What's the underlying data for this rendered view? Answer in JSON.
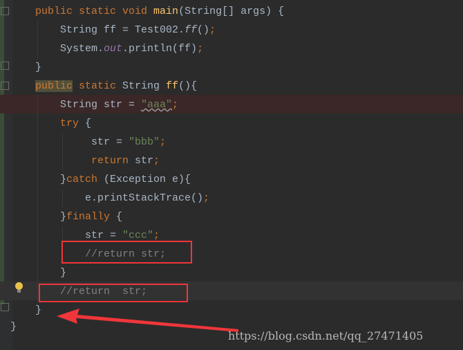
{
  "editor": {
    "lines": [
      {
        "tokens": [
          [
            "public ",
            "kw"
          ],
          [
            "static ",
            "kw"
          ],
          [
            "void ",
            "kw"
          ],
          [
            "main",
            "fn"
          ],
          [
            "(String[] args) {",
            ""
          ]
        ]
      },
      {
        "tokens": [
          [
            "String ff = Test002.",
            ""
          ],
          [
            "ff",
            "it"
          ],
          [
            "()",
            ""
          ],
          [
            ";",
            "pm"
          ]
        ]
      },
      {
        "tokens": [
          [
            "System.",
            ""
          ],
          [
            "out",
            "sf"
          ],
          [
            ".println(ff)",
            ""
          ],
          [
            ";",
            "pm"
          ]
        ]
      },
      {
        "tokens": [
          [
            "}",
            ""
          ]
        ]
      },
      {
        "tokens": [
          [
            "public",
            "kw kwhl"
          ],
          [
            " static ",
            "kw"
          ],
          [
            "String ",
            ""
          ],
          [
            "ff",
            "fn"
          ],
          [
            "(){",
            ""
          ]
        ]
      },
      {
        "tokens": [
          [
            "String str = ",
            ""
          ],
          [
            "\"aaa\"",
            "st squig"
          ],
          [
            ";",
            "pm"
          ]
        ]
      },
      {
        "tokens": [
          [
            "try ",
            "kw"
          ],
          [
            "{",
            ""
          ]
        ]
      },
      {
        "tokens": [
          [
            "str = ",
            ""
          ],
          [
            "\"bbb\"",
            "st"
          ],
          [
            ";",
            "pm"
          ]
        ]
      },
      {
        "tokens": [
          [
            "return ",
            "kw"
          ],
          [
            "str",
            ""
          ],
          [
            ";",
            "pm"
          ]
        ]
      },
      {
        "tokens": [
          [
            "}",
            ""
          ],
          [
            "catch ",
            "kw"
          ],
          [
            "(Exception e){",
            ""
          ]
        ]
      },
      {
        "tokens": [
          [
            "e.printStackTrace()",
            ""
          ],
          [
            ";",
            "pm"
          ]
        ]
      },
      {
        "tokens": [
          [
            "}",
            ""
          ],
          [
            "finally ",
            "kw"
          ],
          [
            "{",
            ""
          ]
        ]
      },
      {
        "tokens": [
          [
            "str = ",
            ""
          ],
          [
            "\"ccc\"",
            "st"
          ],
          [
            ";",
            "pm"
          ]
        ]
      },
      {
        "tokens": [
          [
            "//return str;",
            "cm"
          ]
        ]
      },
      {
        "tokens": [
          [
            "}",
            ""
          ]
        ]
      },
      {
        "tokens": [
          [
            "//return  str;",
            "cm"
          ]
        ]
      },
      {
        "tokens": [
          [
            "}",
            ""
          ]
        ]
      },
      {
        "tokens": [
          [
            "}",
            ""
          ]
        ]
      }
    ]
  },
  "colors": {
    "error_line": "#3b2727",
    "caret_line": "#323232",
    "annotation": "#f0363a"
  },
  "watermark": "https://blog.csdn.net/qq_27471405",
  "icons": {
    "intention": "lightbulb-icon"
  }
}
